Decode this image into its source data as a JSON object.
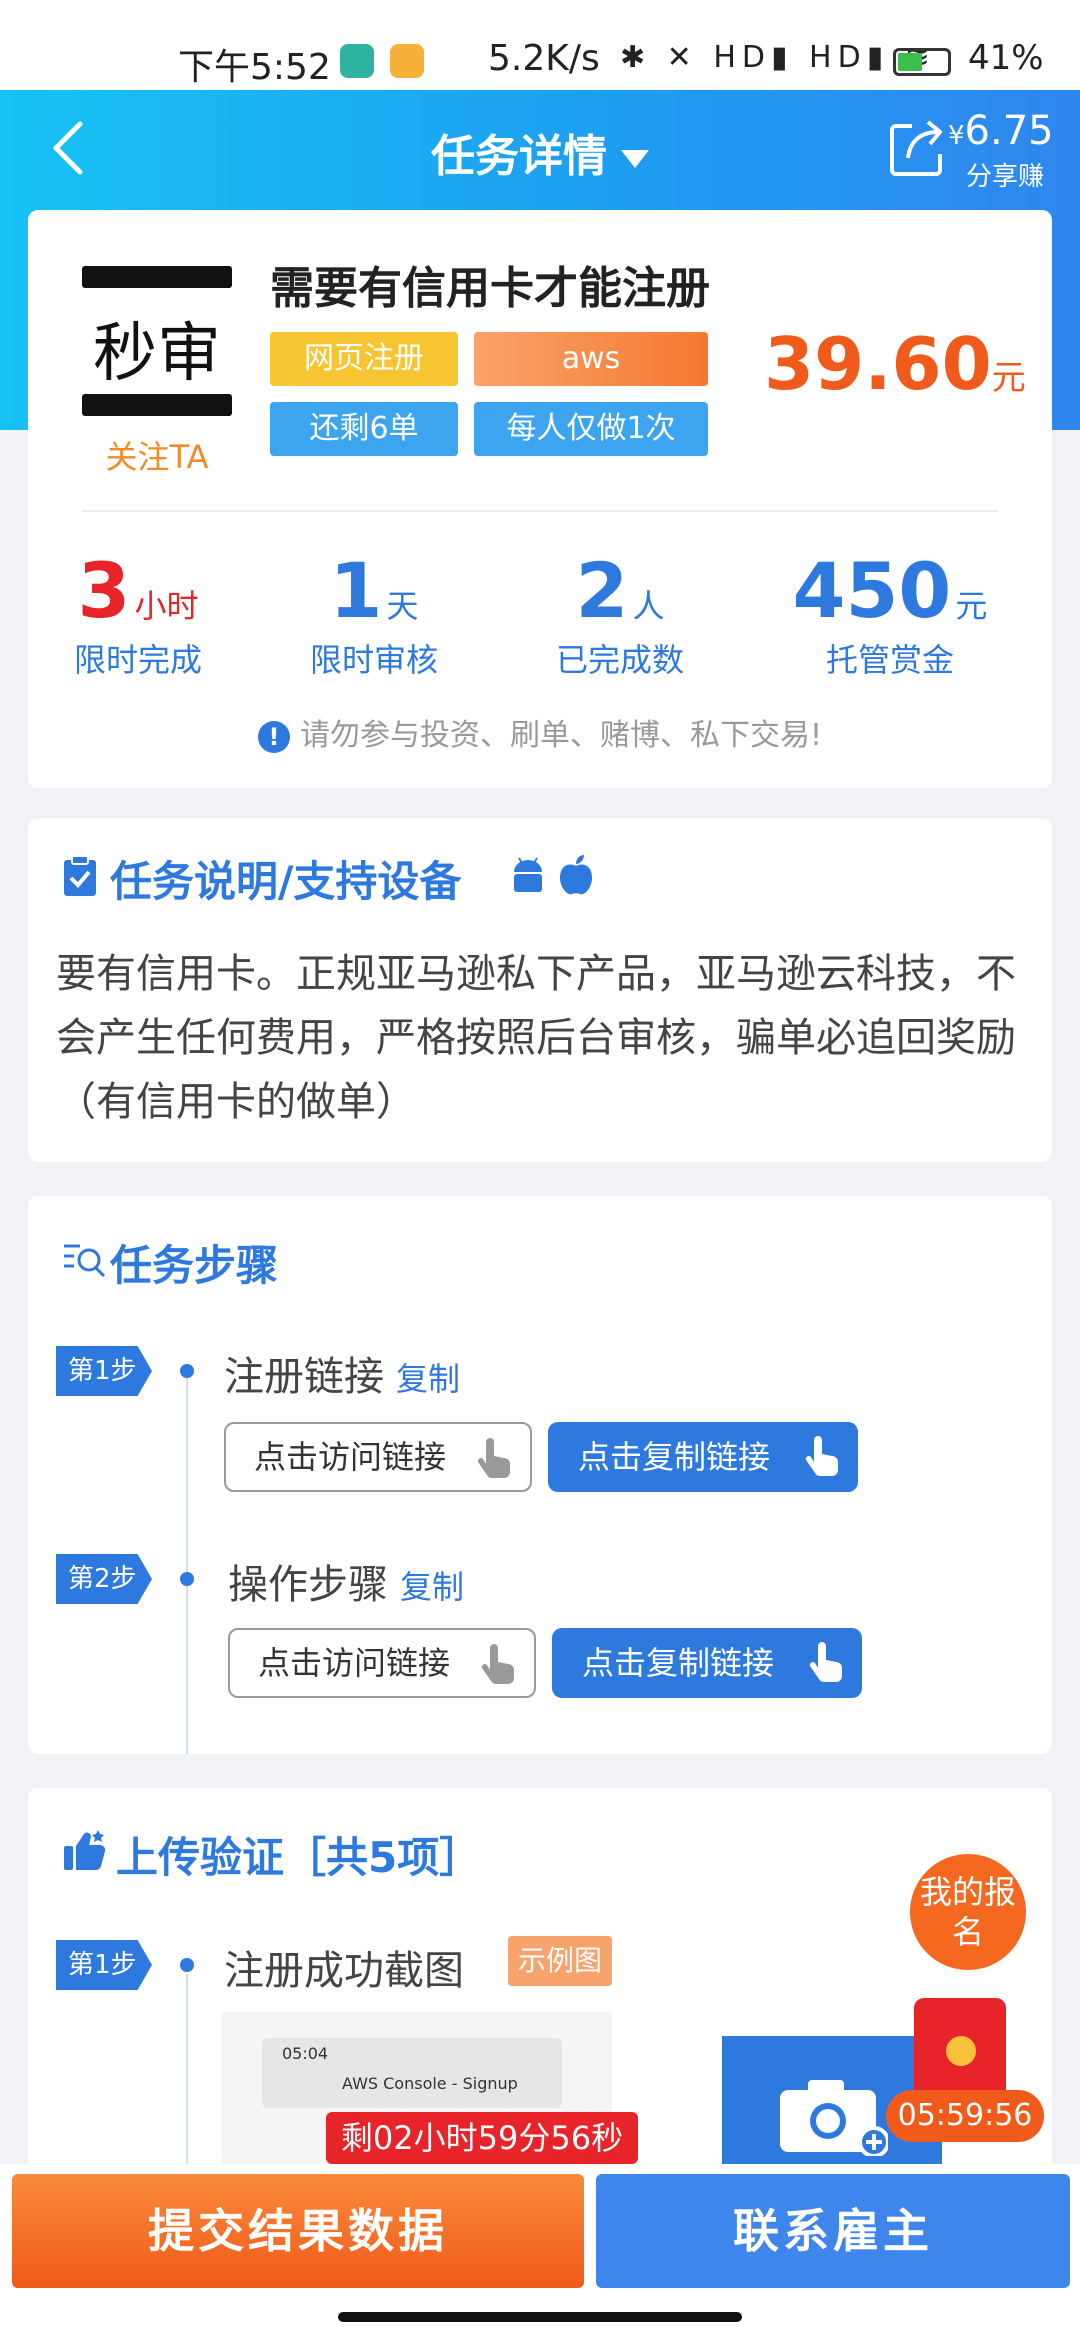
{
  "status_bar": {
    "time": "下午5:52",
    "speed": "5.2K/s",
    "icons_text": "✱ ✕ HD▮ HD▮ ≋",
    "battery": "41%"
  },
  "header": {
    "title": "任务详情",
    "share_amount_prefix": "¥",
    "share_amount": "6.75",
    "share_label": "分享赚"
  },
  "task": {
    "logo_text": "秒审",
    "follow_label": "关注TA",
    "name": "需要有信用卡才能注册",
    "tags": [
      {
        "label": "网页注册",
        "color": "#f7c531"
      },
      {
        "label": "aws",
        "color": "#f4782f"
      },
      {
        "label": "还剩6单",
        "color": "#3da5f0"
      },
      {
        "label": "每人仅做1次",
        "color": "#3da5f0"
      }
    ],
    "price": "39.60",
    "price_unit": "元",
    "stats": [
      {
        "num": "3",
        "unit": "小时",
        "label": "限时完成"
      },
      {
        "num": "1",
        "unit": "天",
        "label": "限时审核"
      },
      {
        "num": "2",
        "unit": "人",
        "label": "已完成数"
      },
      {
        "num": "450",
        "unit": "元",
        "label": "托管赏金"
      }
    ],
    "warning": "请勿参与投资、刷单、赌博、私下交易!"
  },
  "description": {
    "title": "任务说明/支持设备",
    "text": "要有信用卡。正规亚马逊私下产品，亚马逊云科技，不会产生任何费用，严格按照后台审核，骗单必追回奖励（有信用卡的做单）"
  },
  "steps": {
    "title": "任务步骤",
    "items": [
      {
        "badge": "第1步",
        "title": "注册链接",
        "copy": "复制",
        "visit_btn": "点击访问链接",
        "copy_btn": "点击复制链接"
      },
      {
        "badge": "第2步",
        "title": "操作步骤",
        "copy": "复制",
        "visit_btn": "点击访问链接",
        "copy_btn": "点击复制链接"
      }
    ]
  },
  "upload": {
    "title": "上传验证［共5项］",
    "item_badge": "第1步",
    "item_title": "注册成功截图",
    "sample_tag": "示例图",
    "sample_time": "05:04",
    "sample_caption": "AWS Console - Signup"
  },
  "floating": {
    "my_signup": "我的报名",
    "packet_timer": "05:59:56",
    "remaining": "剩02小时59分56秒"
  },
  "bottom": {
    "submit": "提交结果数据",
    "contact": "联系雇主"
  }
}
